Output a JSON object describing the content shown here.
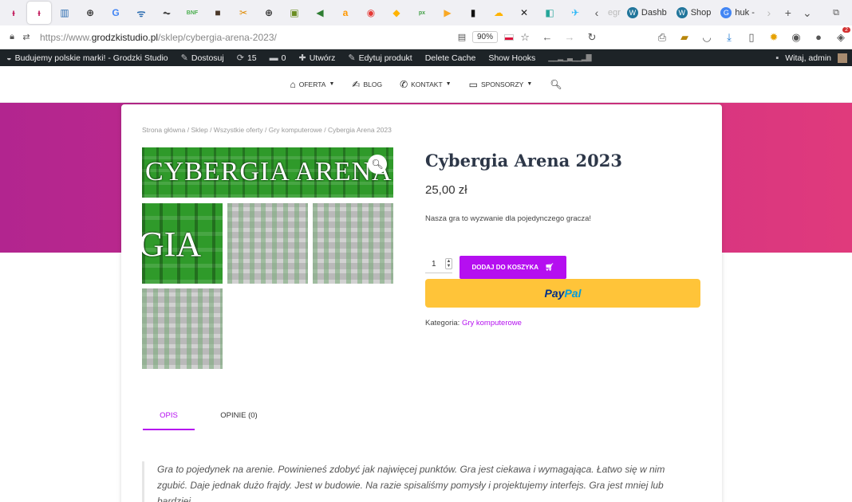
{
  "browser": {
    "tabs_favicons": [
      {
        "icon": "wp-pink-icon",
        "glyph": "ᵻ",
        "color": "#c2185b"
      },
      {
        "icon": "wp-pink-icon",
        "glyph": "ᵻ",
        "color": "#c2185b",
        "active": true
      },
      {
        "icon": "barcode-icon",
        "glyph": "▥",
        "color": "#2b6cb0"
      },
      {
        "icon": "globe-icon",
        "glyph": "⊕",
        "color": "#333"
      },
      {
        "icon": "google-icon",
        "glyph": "G",
        "color": "#4285f4"
      },
      {
        "icon": "wifi-icon",
        "glyph": "ᯤ",
        "color": "#2b6cb0"
      },
      {
        "icon": "waveform-icon",
        "glyph": "⏦",
        "color": "#333"
      },
      {
        "icon": "bnf-icon",
        "glyph": "BNF",
        "color": "#4caf50"
      },
      {
        "icon": "square-dark-icon",
        "glyph": "■",
        "color": "#4a3728"
      },
      {
        "icon": "scissors-icon",
        "glyph": "✂",
        "color": "#e08a00"
      },
      {
        "icon": "globe-icon",
        "glyph": "⊕",
        "color": "#333"
      },
      {
        "icon": "image-icon",
        "glyph": "▣",
        "color": "#6b8e23"
      },
      {
        "icon": "arrow-green-icon",
        "glyph": "◀",
        "color": "#2e7d32"
      },
      {
        "icon": "letter-a-icon",
        "glyph": "a",
        "color": "#ff9800"
      },
      {
        "icon": "red-circle-icon",
        "glyph": "◉",
        "color": "#e53935"
      },
      {
        "icon": "shield-icon",
        "glyph": "◆",
        "color": "#ffb300"
      },
      {
        "icon": "px-icon",
        "glyph": "px",
        "color": "#43a047"
      },
      {
        "icon": "play-icon",
        "glyph": "▶",
        "color": "#f9a825"
      },
      {
        "icon": "book-icon",
        "glyph": "▮",
        "color": "#111"
      },
      {
        "icon": "cloud-icon",
        "glyph": "☁",
        "color": "#ffb300"
      },
      {
        "icon": "x-icon",
        "glyph": "✕",
        "color": "#222"
      },
      {
        "icon": "cube-icon",
        "glyph": "◧",
        "color": "#26a69a"
      },
      {
        "icon": "bird-icon",
        "glyph": "✈",
        "color": "#29b6f6"
      }
    ],
    "tab_back_glyph": "‹",
    "tab_partial_text": "egr",
    "named_tabs": [
      {
        "label": "Dashb",
        "icon": "wordpress-icon",
        "glyph": "W",
        "color": "#21759b"
      },
      {
        "label": "Shop",
        "icon": "wordpress-icon",
        "glyph": "W",
        "color": "#21759b"
      },
      {
        "label": "huk -",
        "icon": "google-icon",
        "glyph": "G",
        "color": "#4285f4"
      }
    ],
    "tab_forward_glyph": "›",
    "new_tab_glyph": "+",
    "tabs_menu_glyph": "⌄",
    "restore_glyph": "⧉",
    "url_prefix": "https://www.",
    "url_domain": "grodzkistudio.pl",
    "url_path": "/sklep/cybergia-arena-2023/",
    "zoom": "90%",
    "extension_badge": "2"
  },
  "adminbar": {
    "site_name": "Budujemy polskie marki! - Grodzki Studio",
    "customize": "Dostosuj",
    "updates": "15",
    "comments": "0",
    "new": "Utwórz",
    "edit_product": "Edytuj produkt",
    "delete_cache": "Delete Cache",
    "show_hooks": "Show Hooks",
    "greeting": "Witaj, admin"
  },
  "nav": {
    "oferta": "OFERTA",
    "blog": "BLOG",
    "kontakt": "KONTAKT",
    "sponsorzy": "SPONSORZY"
  },
  "breadcrumb": {
    "home": "Strona główna",
    "shop": "Sklep",
    "all": "Wszystkie oferty",
    "cat": "Gry komputerowe",
    "current": "Cybergia Arena 2023",
    "sep": " / "
  },
  "gallery": {
    "main_text": "CYBERGIA ARENA",
    "thumb_text": "GIA"
  },
  "product": {
    "title": "Cybergia Arena 2023",
    "price": "25,00 zł",
    "short_desc": "Nasza gra to wyzwanie dla pojedynczego gracza!",
    "qty": "1",
    "add_to_cart": "DODAJ DO KOSZYKA",
    "paypal_1": "Pay",
    "paypal_2": "Pal",
    "category_label": "Kategoria: ",
    "category_link": "Gry komputerowe"
  },
  "tabs": {
    "opis": "OPIS",
    "opinie": "OPINIE (0)"
  },
  "description": "Gra to pojedynek na arenie. Powinieneś zdobyć jak najwięcej punktów. Gra jest ciekawa i wymagająca. Łatwo się w nim zgubić. Daje jednak dużo frajdy. Jest w budowie. Na razie spisaliśmy pomysły i projektujemy interfejs. Gra jest mniej lub bardziej",
  "colors": {
    "accent": "#b50ff0",
    "paypal": "#ffc439",
    "adminbar": "#1d2327"
  }
}
